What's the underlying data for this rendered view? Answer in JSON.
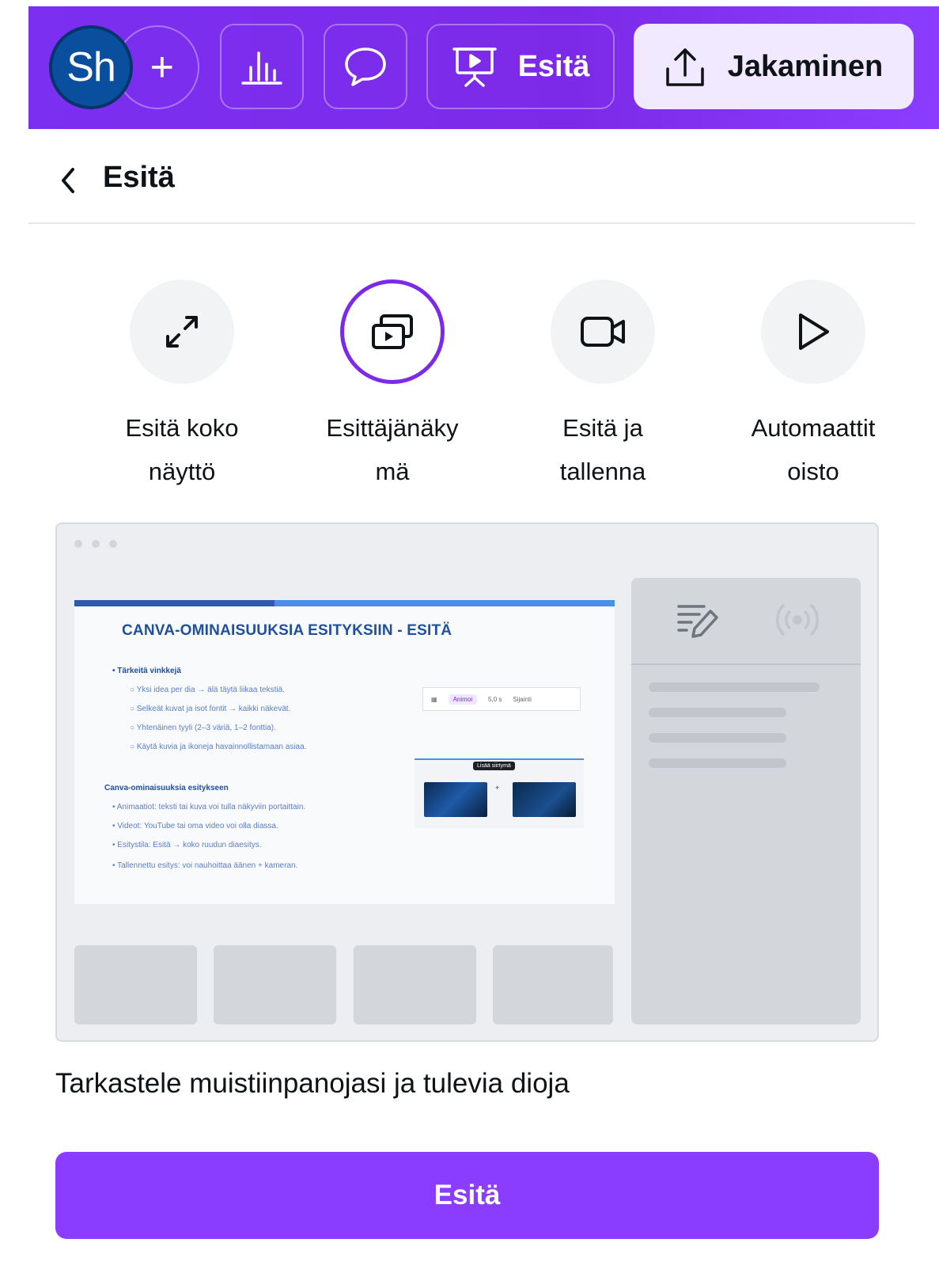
{
  "toolbar": {
    "avatar_initials": "Sh",
    "add_label": "+",
    "present_label": "Esitä",
    "share_label": "Jakaminen",
    "icons": [
      "insights-icon",
      "comment-icon",
      "present-icon",
      "share-upload-icon"
    ]
  },
  "panel": {
    "title": "Esitä",
    "options": [
      {
        "label": "Esitä koko näyttö",
        "line1": "Esitä koko",
        "line2": "näyttö",
        "icon": "expand-arrows-icon",
        "selected": false
      },
      {
        "label": "Esittäjänäkymä",
        "line1": "Esittäjänäky",
        "line2": "mä",
        "icon": "presenter-view-icon",
        "selected": true
      },
      {
        "label": "Esitä ja tallenna",
        "line1": "Esitä ja",
        "line2": "tallenna",
        "icon": "video-camera-icon",
        "selected": false
      },
      {
        "label": "Automaattitoisto",
        "line1": "Automaattit",
        "line2": "oisto",
        "icon": "play-icon",
        "selected": false
      }
    ],
    "preview": {
      "slide_title": "CANVA-OMINAISUUKSIA ESITYKSIIN - ESITÄ",
      "bullet_heading": "Tärkeitä vinkkejä",
      "bullets": [
        "Yksi idea per dia → älä täytä liikaa tekstiä.",
        "Selkeät kuvat ja isot fontit → kaikki näkevät.",
        "Yhtenäinen tyyli (2–3 väriä, 1–2 fonttia).",
        "Käytä kuvia ja ikoneja havainnollistamaan asiaa."
      ],
      "features_heading": "Canva-ominaisuuksia esitykseen",
      "features": [
        "Animaatiot: teksti tai kuva voi tulla näkyviin portaittain.",
        "Videot: YouTube tai oma video voi olla diassa.",
        "Esitystila: Esitä → koko ruudun diaesitys.",
        "Tallennettu esitys: voi nauhoittaa äänen + kameran."
      ],
      "mini_toolbar": {
        "animate": "Animoi",
        "duration": "5,0 s",
        "position": "Sijainti"
      },
      "mini_tag": "Lisää siirtymä"
    },
    "caption": "Tarkastele muistiinpanojasi ja tulevia dioja",
    "primary_button": "Esitä"
  },
  "colors": {
    "brand_purple": "#7d2ae8",
    "button_purple": "#8b3dff",
    "share_bg": "#f1e9ff",
    "avatar_blue": "#0a4f9e"
  }
}
